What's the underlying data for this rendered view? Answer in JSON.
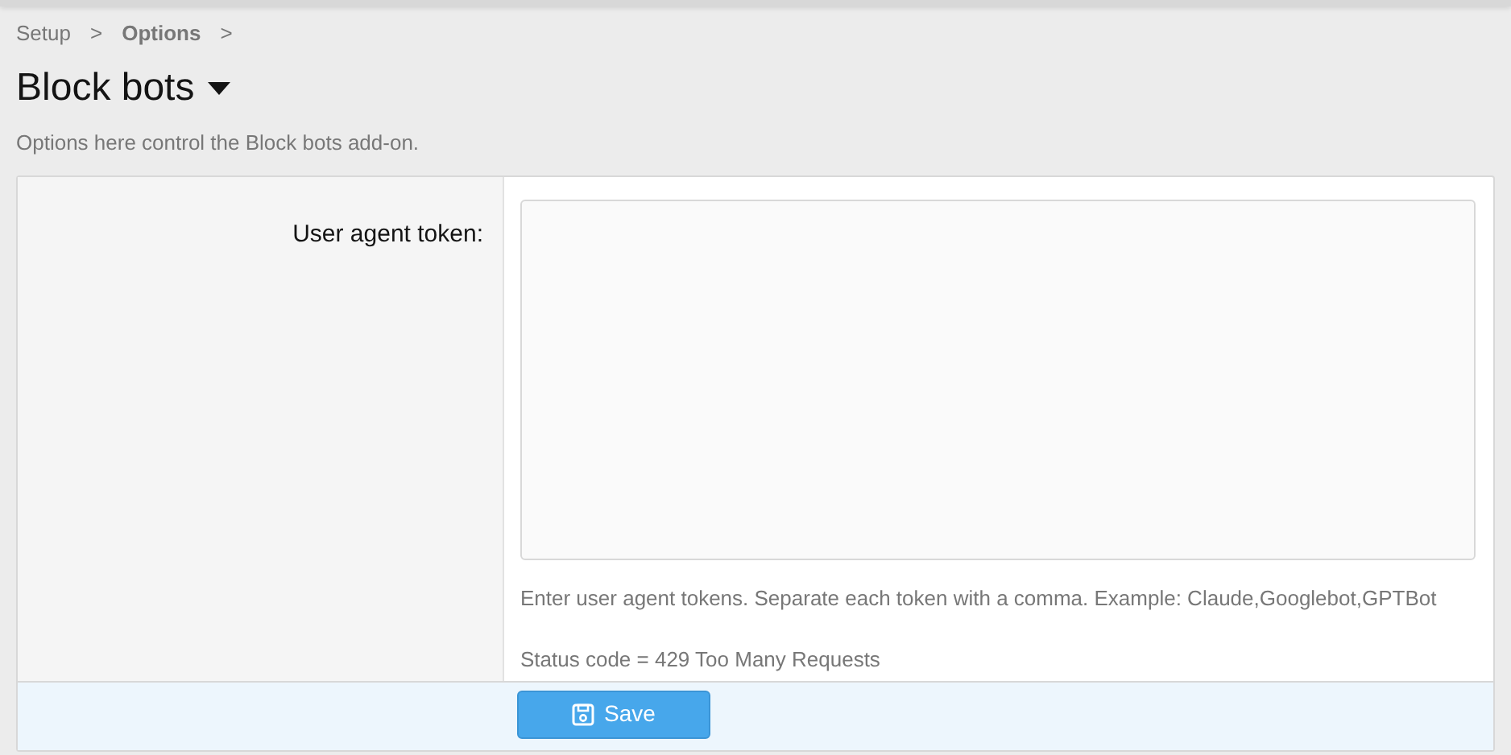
{
  "breadcrumb": [
    {
      "label": "Setup",
      "bold": false
    },
    {
      "label": "Options",
      "bold": true
    }
  ],
  "breadcrumb_separator": ">",
  "title": "Block bots",
  "description": "Options here control the Block bots add-on.",
  "form": {
    "label": "User agent token:",
    "help": [
      "Enter user agent tokens. Separate each token with a comma. Example: Claude,Googlebot,GPTBot",
      "Status code = 429 Too Many Requests"
    ]
  },
  "save_button": "Save"
}
